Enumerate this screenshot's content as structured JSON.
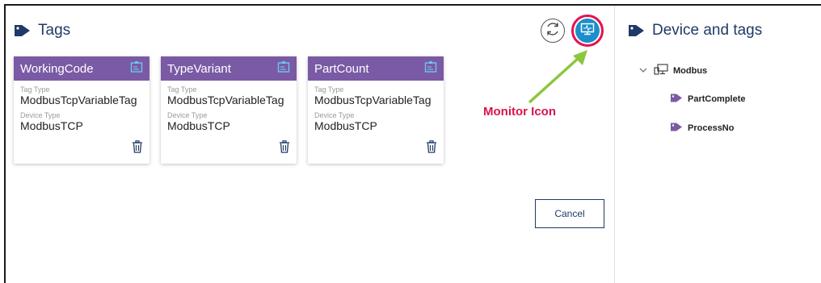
{
  "left_panel": {
    "title": "Tags"
  },
  "right_panel": {
    "title": "Device and tags"
  },
  "cards": [
    {
      "name": "WorkingCode",
      "tag_type_label": "Tag Type",
      "tag_type": "ModbusTcpVariableTag",
      "device_type_label": "Device Type",
      "device_type": "ModbusTCP"
    },
    {
      "name": "TypeVariant",
      "tag_type_label": "Tag Type",
      "tag_type": "ModbusTcpVariableTag",
      "device_type_label": "Device Type",
      "device_type": "ModbusTCP"
    },
    {
      "name": "PartCount",
      "tag_type_label": "Tag Type",
      "tag_type": "ModbusTcpVariableTag",
      "device_type_label": "Device Type",
      "device_type": "ModbusTCP"
    }
  ],
  "annotation": {
    "label": "Monitor Icon"
  },
  "buttons": {
    "cancel": "Cancel"
  },
  "tree": {
    "device": "Modbus",
    "tags": [
      "PartComplete",
      "ProcessNo"
    ]
  },
  "colors": {
    "card_header": "#7a5aa4",
    "accent_blue": "#1a8fcb",
    "highlight_ring": "#e8104e",
    "arrow": "#8cc63f",
    "title_text": "#1f3a68"
  }
}
